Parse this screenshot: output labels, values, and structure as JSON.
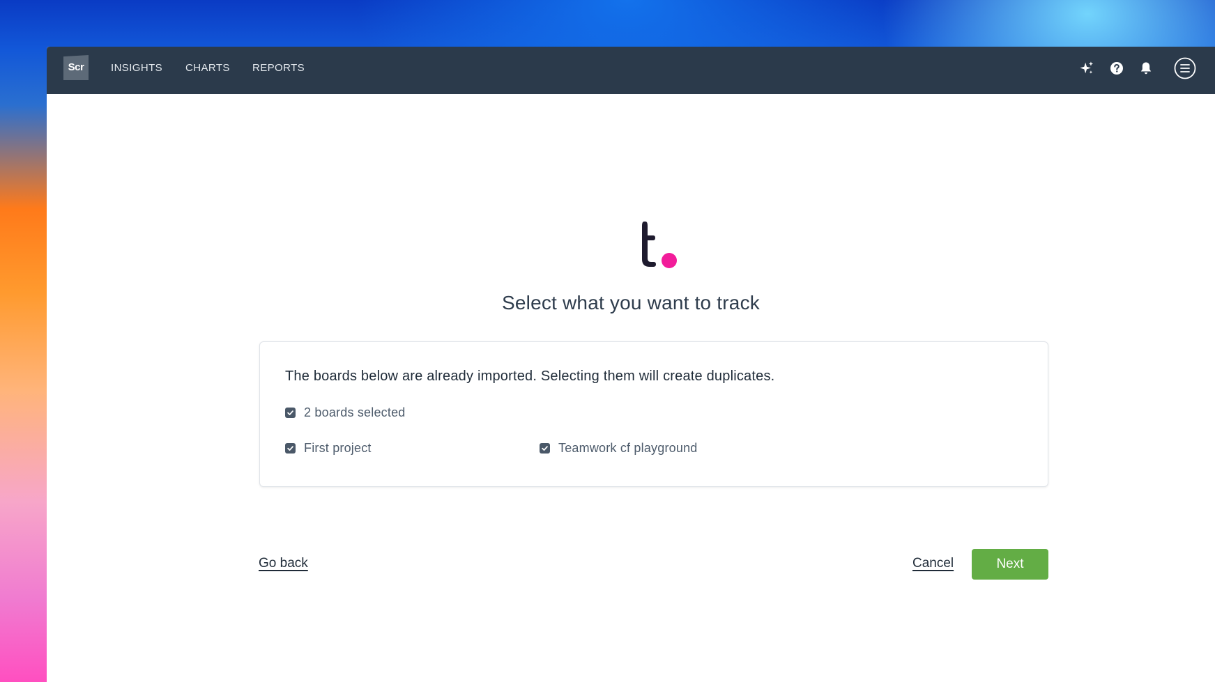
{
  "app": {
    "logo_text": "Scr"
  },
  "nav": {
    "items": [
      {
        "label": "INSIGHTS"
      },
      {
        "label": "CHARTS"
      },
      {
        "label": "REPORTS"
      }
    ]
  },
  "header_icons": [
    "sparkles-icon",
    "help-icon",
    "bell-icon",
    "menu-icon"
  ],
  "brand": {
    "letter_color": "#1e1b2e",
    "dot_color": "#f21c9a"
  },
  "page": {
    "title": "Select what you want to track"
  },
  "card": {
    "message": "The boards below are already imported. Selecting them will create duplicates.",
    "select_all": {
      "label": "2 boards selected",
      "checked": true
    },
    "boards": [
      {
        "label": "First project",
        "checked": true
      },
      {
        "label": "Teamwork cf playground",
        "checked": true
      }
    ]
  },
  "actions": {
    "back_label": "Go back",
    "cancel_label": "Cancel",
    "next_label": "Next"
  },
  "colors": {
    "topbar": "#2b3a4b",
    "accent_green": "#63ad45",
    "checkbox": "#4a5868"
  }
}
